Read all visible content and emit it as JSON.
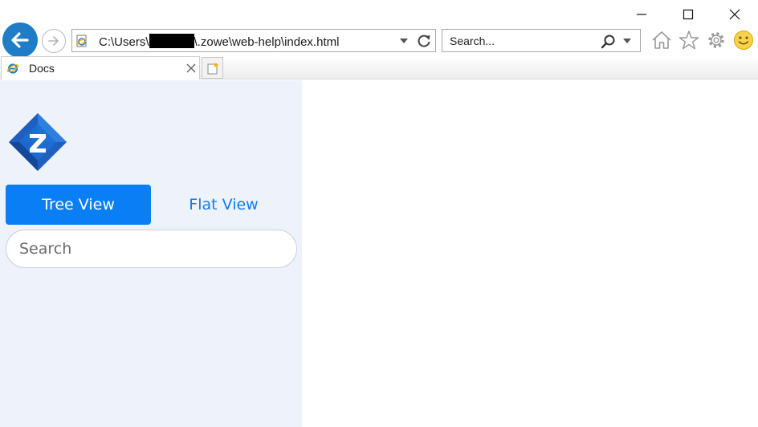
{
  "browser": {
    "address": {
      "url_prefix": "C:\\Users\\",
      "url_suffix": "\\.zowe\\web-help\\index.html"
    },
    "search": {
      "placeholder": "Search..."
    },
    "tabs": [
      {
        "title": "Docs"
      }
    ]
  },
  "sidebar": {
    "view_toggle": {
      "tree_label": "Tree View",
      "flat_label": "Flat View",
      "active": "tree"
    },
    "search": {
      "placeholder": "Search"
    }
  },
  "colors": {
    "accent": "#0a7ff5",
    "sidebar_bg": "#edf2fb",
    "back_button": "#1e7dc6"
  },
  "icons": {
    "back": "back-arrow-icon",
    "forward": "forward-arrow-icon",
    "refresh": "refresh-icon",
    "search": "magnifier-icon",
    "home": "home-icon",
    "favorites": "star-icon",
    "tools": "gear-icon",
    "feedback": "smiley-icon",
    "logo": "zowe-logo"
  }
}
